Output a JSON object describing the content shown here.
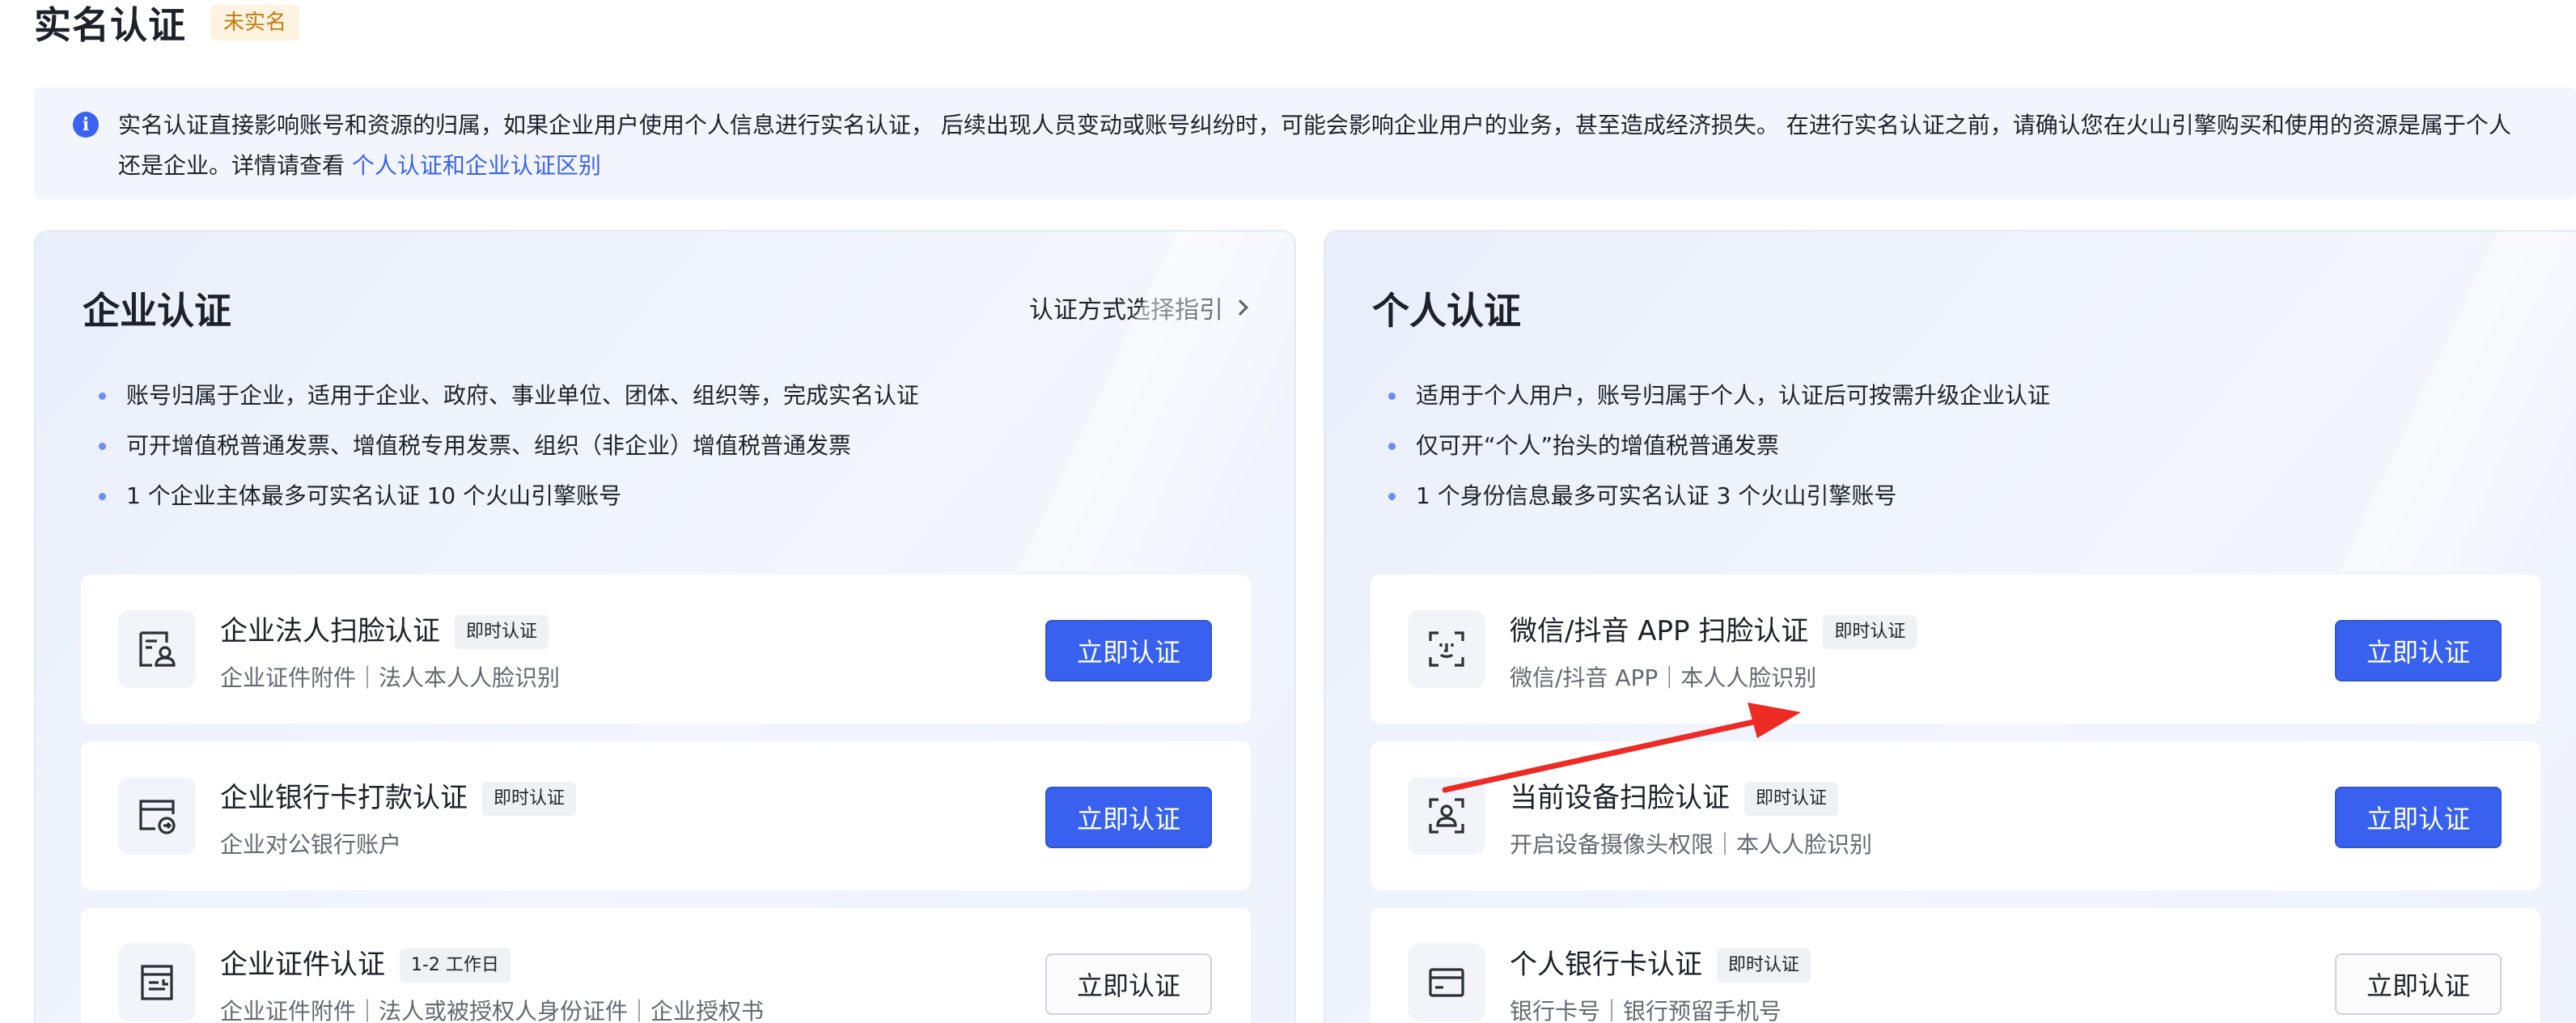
{
  "header": {
    "title": "实名认证",
    "status_badge": "未实名"
  },
  "notice": {
    "text": "实名认证直接影响账号和资源的归属，如果企业用户使用个人信息进行实名认证， 后续出现人员变动或账号纠纷时，可能会影响企业用户的业务，甚至造成经济损失。 在进行实名认证之前，请确认您在火山引擎购买和使用的资源是属于个人还是企业。详情请查看 ",
    "link": "个人认证和企业认证区别"
  },
  "enterprise": {
    "title": "企业认证",
    "guide_link": "认证方式选择指引",
    "bullets": [
      "账号归属于企业，适用于企业、政府、事业单位、团体、组织等，完成实名认证",
      "可开增值税普通发票、增值税专用发票、组织（非企业）增值税普通发票",
      "1 个企业主体最多可实名认证 10 个火山引擎账号"
    ],
    "methods": [
      {
        "name": "企业法人扫脸认证",
        "tag": "即时认证",
        "desc": "企业证件附件｜法人本人人脸识别",
        "button": "立即认证",
        "icon": "face-scan-id-icon"
      },
      {
        "name": "企业银行卡打款认证",
        "tag": "即时认证",
        "desc": "企业对公银行账户",
        "button": "立即认证",
        "icon": "bank-card-transfer-icon"
      },
      {
        "name": "企业证件认证",
        "tag": "1-2 工作日",
        "desc": "企业证件附件｜法人或被授权人身份证件｜企业授权书",
        "button": "立即认证",
        "icon": "certificate-icon"
      }
    ]
  },
  "personal": {
    "title": "个人认证",
    "bullets": [
      "适用于个人用户，账号归属于个人，认证后可按需升级企业认证",
      "仅可开“个人”抬头的增值税普通发票",
      "1 个身份信息最多可实名认证 3 个火山引擎账号"
    ],
    "methods": [
      {
        "name": "微信/抖音 APP 扫脸认证",
        "tag": "即时认证",
        "desc": "微信/抖音 APP｜本人人脸识别",
        "button": "立即认证",
        "icon": "face-scan-icon"
      },
      {
        "name": "当前设备扫脸认证",
        "tag": "即时认证",
        "desc": "开启设备摄像头权限｜本人人脸识别",
        "button": "立即认证",
        "icon": "device-face-scan-icon"
      },
      {
        "name": "个人银行卡认证",
        "tag": "即时认证",
        "desc": "银行卡号｜银行预留手机号",
        "button": "立即认证",
        "icon": "bank-card-icon"
      }
    ]
  },
  "colors": {
    "accent": "#3761ee",
    "annotation": "#ee2a24",
    "badge_bg": "#fdf3e0",
    "badge_text": "#c27c0e"
  }
}
